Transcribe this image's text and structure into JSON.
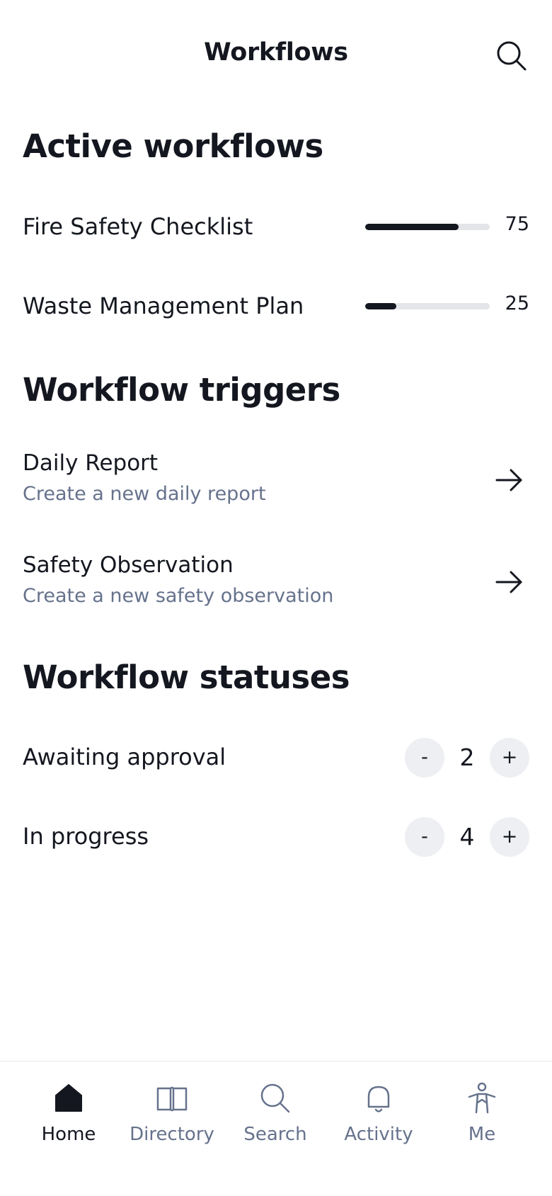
{
  "header": {
    "title": "Workflows",
    "search_icon": "search-icon"
  },
  "active_workflows": {
    "title": "Active workflows",
    "items": [
      {
        "label": "Fire Safety Checklist",
        "progress": 75,
        "value": "75"
      },
      {
        "label": "Waste Management Plan",
        "progress": 25,
        "value": "25"
      }
    ]
  },
  "triggers": {
    "title": "Workflow triggers",
    "items": [
      {
        "title": "Daily Report",
        "subtitle": "Create a new daily report",
        "icon": "arrow-right-icon"
      },
      {
        "title": "Safety Observation",
        "subtitle": "Create a new safety observation",
        "icon": "arrow-right-icon"
      }
    ]
  },
  "statuses": {
    "title": "Workflow statuses",
    "items": [
      {
        "label": "Awaiting approval",
        "count": "2",
        "minus": "-",
        "plus": "+"
      },
      {
        "label": "In progress",
        "count": "4",
        "minus": "-",
        "plus": "+"
      }
    ]
  },
  "tabbar": {
    "items": [
      {
        "label": "Home",
        "icon": "home-icon",
        "active": true
      },
      {
        "label": "Directory",
        "icon": "book-icon",
        "active": false
      },
      {
        "label": "Search",
        "icon": "search-icon",
        "active": false
      },
      {
        "label": "Activity",
        "icon": "bell-icon",
        "active": false
      },
      {
        "label": "Me",
        "icon": "person-icon",
        "active": false
      }
    ]
  },
  "colors": {
    "text": "#14171f",
    "muted": "#66728c",
    "track": "#e3e5e9",
    "stepper_bg": "#eeeff2"
  }
}
